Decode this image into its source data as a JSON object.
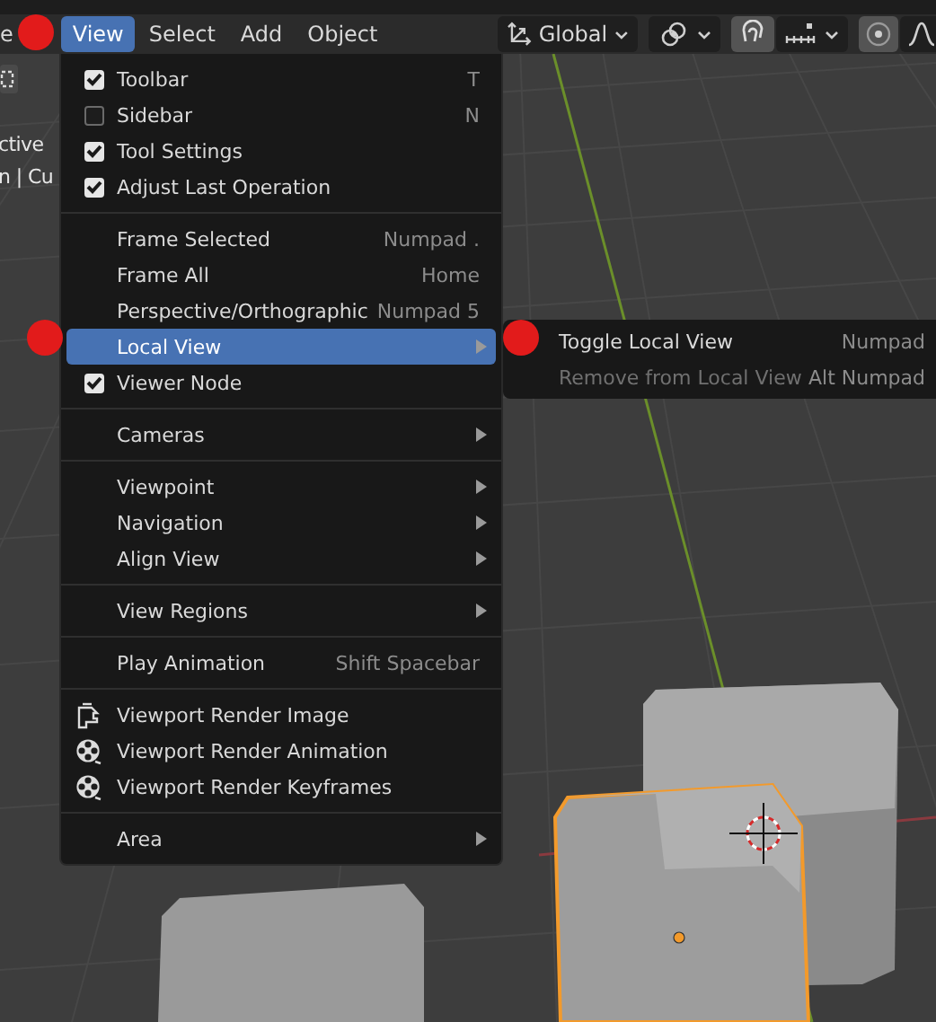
{
  "header": {
    "cut_label": "e",
    "menus": [
      {
        "label": "View",
        "selected": true
      },
      {
        "label": "Select",
        "selected": false
      },
      {
        "label": "Add",
        "selected": false
      },
      {
        "label": "Object",
        "selected": false
      }
    ],
    "orientation": "Global"
  },
  "viewport_overlay": {
    "lines": [
      "ctive",
      "n | Cu"
    ]
  },
  "menu": {
    "sections": [
      [
        {
          "kind": "check",
          "label": "Toolbar",
          "shortcut": "T",
          "checked": true,
          "selected": false
        },
        {
          "kind": "check",
          "label": "Sidebar",
          "shortcut": "N",
          "checked": false,
          "selected": false
        },
        {
          "kind": "check",
          "label": "Tool Settings",
          "checked": true,
          "selected": false
        },
        {
          "kind": "check",
          "label": "Adjust Last Operation",
          "checked": true,
          "selected": false
        }
      ],
      [
        {
          "kind": "plain",
          "label": "Frame Selected",
          "shortcut": "Numpad .",
          "selected": false
        },
        {
          "kind": "plain",
          "label": "Frame All",
          "shortcut": "Home",
          "selected": false
        },
        {
          "kind": "plain",
          "label": "Perspective/Orthographic",
          "shortcut": "Numpad 5",
          "selected": false
        },
        {
          "kind": "submenu",
          "label": "Local View",
          "selected": true
        },
        {
          "kind": "check",
          "label": "Viewer Node",
          "checked": true,
          "selected": false
        }
      ],
      [
        {
          "kind": "submenu",
          "label": "Cameras",
          "selected": false
        }
      ],
      [
        {
          "kind": "submenu",
          "label": "Viewpoint",
          "selected": false
        },
        {
          "kind": "submenu",
          "label": "Navigation",
          "selected": false
        },
        {
          "kind": "submenu",
          "label": "Align View",
          "selected": false
        }
      ],
      [
        {
          "kind": "submenu",
          "label": "View Regions",
          "selected": false
        }
      ],
      [
        {
          "kind": "plain",
          "label": "Play Animation",
          "shortcut": "Shift Spacebar",
          "selected": false
        }
      ],
      [
        {
          "kind": "still",
          "label": "Viewport Render Image",
          "selected": false
        },
        {
          "kind": "reel",
          "label": "Viewport Render Animation",
          "selected": false
        },
        {
          "kind": "reel",
          "label": "Viewport Render Keyframes",
          "selected": false
        }
      ],
      [
        {
          "kind": "submenu",
          "label": "Area",
          "selected": false
        }
      ]
    ]
  },
  "submenu": {
    "items": [
      {
        "label": "Toggle Local View",
        "shortcut": "Numpad",
        "disabled": false
      },
      {
        "label": "Remove from Local View",
        "shortcut": "Alt Numpad",
        "disabled": true
      }
    ]
  }
}
